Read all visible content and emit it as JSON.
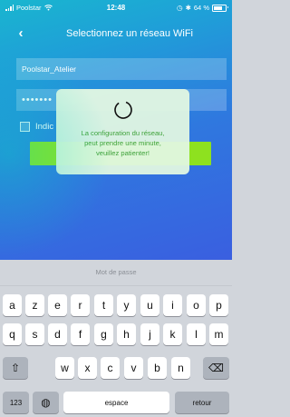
{
  "status_bar": {
    "carrier": "Poolstar",
    "time": "12:48",
    "battery": "64 %"
  },
  "nav": {
    "back_icon": "chevron-left-icon",
    "title": "Selectionnez un réseau WiFi"
  },
  "form": {
    "ssid_value": "Poolstar_Atelier",
    "password_value": "•••••••",
    "checkbox_label": "Indic"
  },
  "modal": {
    "spinner_icon": "loading-spinner-icon",
    "message_line1": "La configuration du réseau,",
    "message_line2": "peut prendre une minute,",
    "message_line3": "veuillez patienter!"
  },
  "keyboard": {
    "hint": "Mot de passe",
    "row1": [
      "a",
      "z",
      "e",
      "r",
      "t",
      "y",
      "u",
      "i",
      "o",
      "p"
    ],
    "row2": [
      "q",
      "s",
      "d",
      "f",
      "g",
      "h",
      "j",
      "k",
      "l",
      "m"
    ],
    "row3": [
      "w",
      "x",
      "c",
      "v",
      "b",
      "n"
    ],
    "numbers_label": "123",
    "space_label": "espace",
    "return_label": "retour",
    "shift_icon": "shift-icon",
    "backspace_icon": "backspace-icon",
    "globe_icon": "globe-icon"
  },
  "colors": {
    "accent_green": "#8ee11f",
    "modal_text_green": "#3fa23a"
  }
}
